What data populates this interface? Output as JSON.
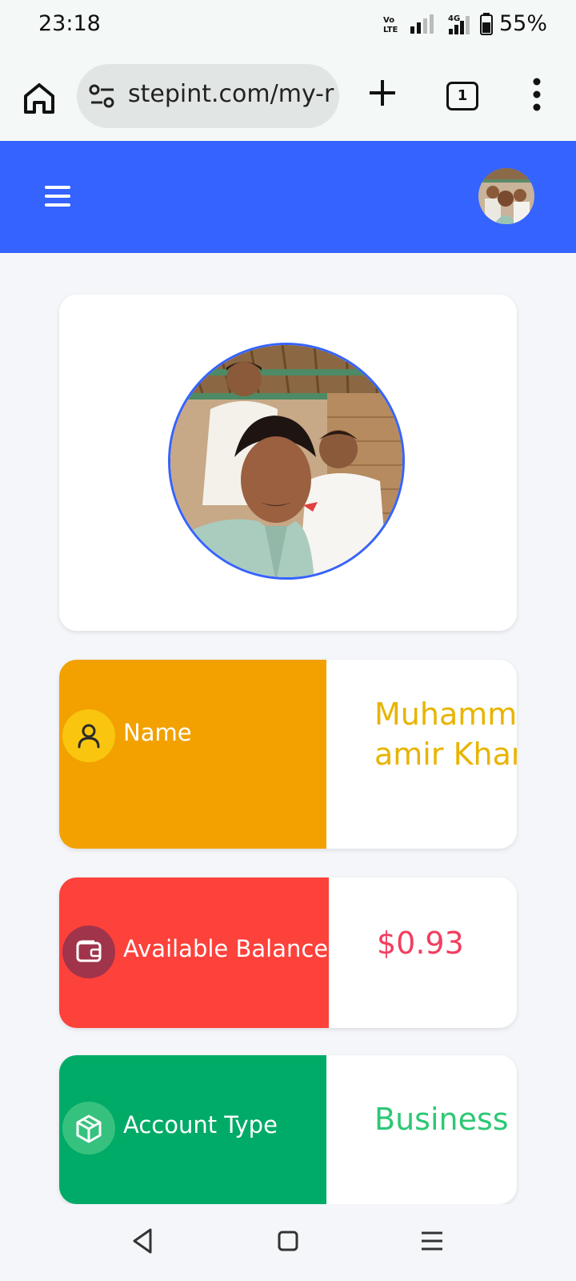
{
  "status": {
    "time": "23:18",
    "battery": "55%",
    "volte": "Vo LTE",
    "network": "4G"
  },
  "browser": {
    "url": "stepint.com/my-r",
    "tab_count": "1"
  },
  "profile": {
    "name_label": "Name",
    "name_value_line1": "Muhamm",
    "name_value_line2": "amir Khar",
    "balance_label": "Available Balance",
    "balance_value": "$0.93",
    "account_type_label": "Account Type",
    "account_type_value": "Business"
  },
  "colors": {
    "brand_blue": "#3563fe",
    "name_bg": "#f2a100",
    "name_value": "#e8b400",
    "balance_bg": "#fd413b",
    "balance_value": "#f23e5f",
    "type_bg": "#00ab67",
    "type_value": "#2dc875"
  },
  "icons": {
    "home": "home-icon",
    "site_settings": "tune-icon",
    "new_tab": "plus-icon",
    "menu": "more-vert-icon",
    "hamburger": "hamburger-icon",
    "name": "user-icon",
    "balance": "wallet-icon",
    "type": "cube-icon",
    "back": "back-icon",
    "home_nav": "home-square-icon",
    "recents": "recents-icon"
  }
}
